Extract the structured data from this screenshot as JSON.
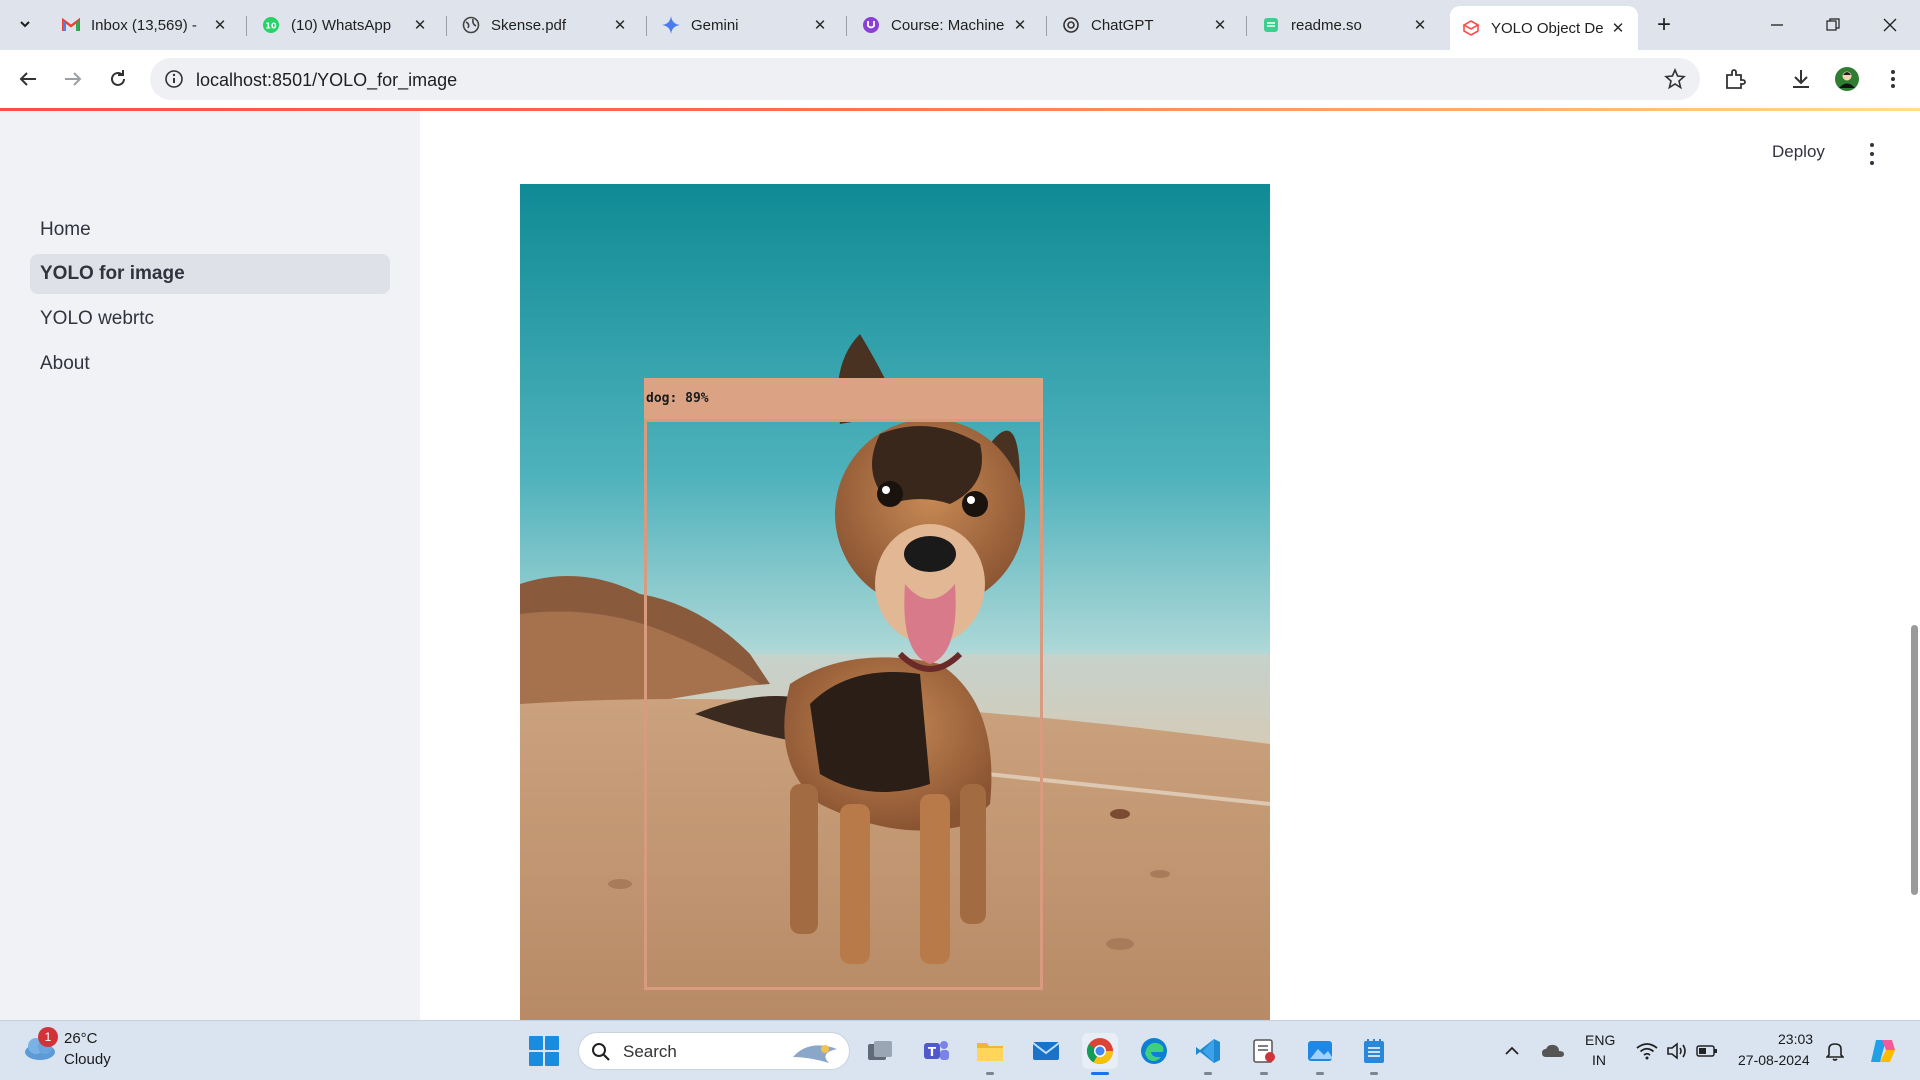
{
  "browser": {
    "tabs": [
      {
        "title": "Inbox (13,569) - ",
        "favicon": "gmail-icon"
      },
      {
        "title": "(10) WhatsApp",
        "favicon": "whatsapp-icon"
      },
      {
        "title": "Skense.pdf",
        "favicon": "globe-icon"
      },
      {
        "title": "Gemini",
        "favicon": "gemini-icon"
      },
      {
        "title": "Course: Machine",
        "favicon": "course-icon"
      },
      {
        "title": "ChatGPT",
        "favicon": "chatgpt-icon"
      },
      {
        "title": "readme.so",
        "favicon": "readme-icon"
      },
      {
        "title": "YOLO Object De",
        "favicon": "streamlit-icon",
        "active": true
      }
    ],
    "url": "localhost:8501/YOLO_for_image"
  },
  "app": {
    "sidebar": {
      "items": [
        {
          "label": "Home"
        },
        {
          "label": "YOLO for image",
          "active": true
        },
        {
          "label": "YOLO webrtc"
        },
        {
          "label": "About"
        }
      ]
    },
    "header": {
      "deploy_label": "Deploy"
    },
    "detection": {
      "label": "dog: 89%",
      "box_color": "#d99b7f"
    }
  },
  "taskbar": {
    "weather": {
      "badge": "1",
      "temp": "26°C",
      "condition": "Cloudy"
    },
    "search_placeholder": "Search",
    "language": {
      "line1": "ENG",
      "line2": "IN"
    },
    "time": "23:03",
    "date": "27-08-2024"
  },
  "colors": {
    "accent_red": "#ff4b4b",
    "sidebar_bg": "#f0f2f6",
    "tab_strip_bg": "#dfe3eb"
  }
}
